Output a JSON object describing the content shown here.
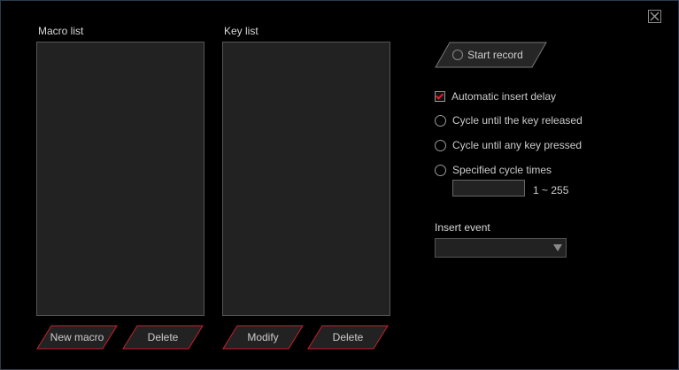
{
  "close_icon": "close-icon",
  "macro_list": {
    "label": "Macro list",
    "new_label": "New macro",
    "delete_label": "Delete"
  },
  "key_list": {
    "label": "Key list",
    "modify_label": "Modify",
    "delete_label": "Delete"
  },
  "start_record": "Start record",
  "options": {
    "auto_delay": "Automatic insert delay",
    "auto_delay_checked": true,
    "cycle_release": "Cycle until the key released",
    "cycle_any": "Cycle until any key pressed",
    "specified": "Specified cycle times",
    "cycle_value": "",
    "range": "1 ~ 255"
  },
  "insert_event": {
    "label": "Insert event",
    "value": ""
  },
  "colors": {
    "accent": "#c8202c",
    "border": "#2c3b4e"
  }
}
